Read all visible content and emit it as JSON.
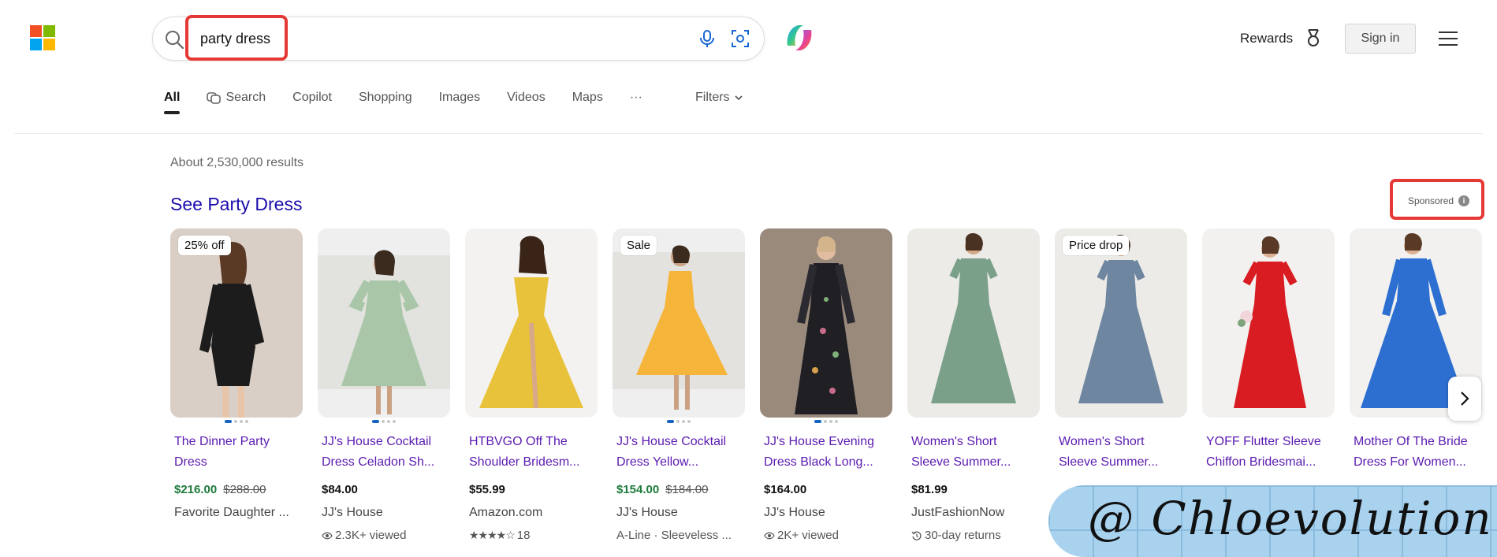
{
  "header": {
    "query": "party dress",
    "rewards_label": "Rewards",
    "signin_label": "Sign in"
  },
  "tabs": [
    {
      "label": "All"
    },
    {
      "label": "Search"
    },
    {
      "label": "Copilot"
    },
    {
      "label": "Shopping"
    },
    {
      "label": "Images"
    },
    {
      "label": "Videos"
    },
    {
      "label": "Maps"
    },
    {
      "label": "···"
    }
  ],
  "filters_label": "Filters",
  "results": {
    "count": "About 2,530,000 results",
    "ad_title": "See Party Dress",
    "sponsored": "Sponsored"
  },
  "colors": {
    "ms_red": "#f25022",
    "ms_green": "#7fba00",
    "ms_blue": "#00a4ef",
    "ms_yellow": "#ffb900",
    "link": "#1a0dab",
    "product_link": "#5b1bb0",
    "sale_price": "#1e7a3c",
    "highlight": "#e53935"
  },
  "products": [
    {
      "badge": "25% off",
      "title": "The Dinner Party Dress",
      "price": "$216.00",
      "old_price": "$288.00",
      "seller": "Favorite Daughter ...",
      "meta": ""
    },
    {
      "badge": "",
      "title": "JJ's House Cocktail Dress Celadon Sh...",
      "price": "$84.00",
      "old_price": "",
      "seller": "JJ's House",
      "meta": "2.3K+ viewed",
      "meta_icon": "eye-icon"
    },
    {
      "badge": "",
      "title": "HTBVGO Off The Shoulder Bridesm...",
      "price": "$55.99",
      "old_price": "",
      "seller": "Amazon.com",
      "meta": "18",
      "meta_icon": "stars-icon"
    },
    {
      "badge": "Sale",
      "title": "JJ's House Cocktail Dress Yellow...",
      "price": "$154.00",
      "old_price": "$184.00",
      "seller": "JJ's House",
      "meta": "A-Line · Sleeveless ...",
      "meta_icon": ""
    },
    {
      "badge": "",
      "title": "JJ's House Evening Dress Black Long...",
      "price": "$164.00",
      "old_price": "",
      "seller": "JJ's House",
      "meta": "2K+ viewed",
      "meta_icon": "eye-icon"
    },
    {
      "badge": "",
      "title": "Women's Short Sleeve Summer...",
      "price": "$81.99",
      "old_price": "",
      "seller": "JustFashionNow",
      "meta": "30-day returns",
      "meta_icon": "return-icon"
    },
    {
      "badge": "Price drop",
      "title": "Women's Short Sleeve Summer...",
      "price": "",
      "old_price": "",
      "seller": "",
      "meta": ""
    },
    {
      "badge": "",
      "title": "YOFF Flutter Sleeve Chiffon Bridesmai...",
      "price": "",
      "old_price": "",
      "seller": "",
      "meta": ""
    },
    {
      "badge": "",
      "title": "Mother Of The Bride Dress For Women...",
      "price": "",
      "old_price": "",
      "seller": "",
      "meta": ""
    }
  ],
  "watermark": "@ Chloevolution"
}
